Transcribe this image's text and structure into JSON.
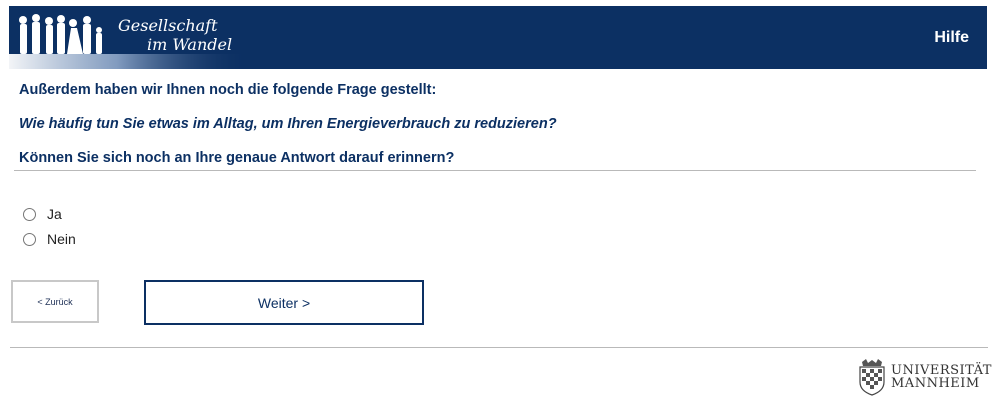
{
  "header": {
    "logo_line1": "Gesellschaft",
    "logo_line2": "im Wandel",
    "help_label": "Hilfe",
    "background_color": "#0c3063"
  },
  "question": {
    "intro": "Außerdem haben wir Ihnen noch die folgende Frage gestellt:",
    "main": "Wie häufig tun Sie etwas im Alltag, um Ihren Energieverbrauch zu reduzieren?",
    "followup": "Können Sie sich noch an Ihre genaue Antwort darauf erinnern?"
  },
  "options": [
    {
      "label": "Ja",
      "selected": false
    },
    {
      "label": "Nein",
      "selected": false
    }
  ],
  "buttons": {
    "back_label": "< Zurück",
    "next_label": "Weiter >"
  },
  "footer": {
    "university_line1": "UNIVERSITÄT",
    "university_line2": "MANNHEIM",
    "crest_icon": "university-crest-icon"
  }
}
